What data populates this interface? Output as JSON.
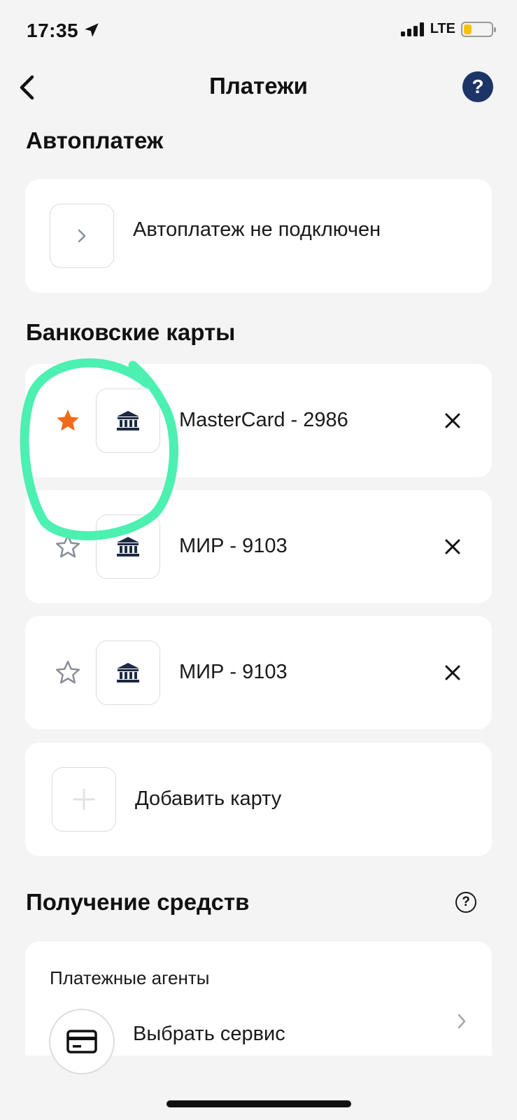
{
  "status_bar": {
    "time": "17:35",
    "network": "LTE",
    "battery_color": "#f5c400",
    "icons": [
      "location-arrow-icon",
      "signal-icon",
      "battery-icon"
    ]
  },
  "nav": {
    "title": "Платежи",
    "back_icon": "chevron-left-icon",
    "help_label": "?",
    "help_color": "#1d3566"
  },
  "autopay": {
    "section_title": "Автоплатеж",
    "status_text": "Автоплатеж не подключен",
    "icon": "chevron-right-icon"
  },
  "bank_cards": {
    "section_title": "Банковские карты",
    "cards": [
      {
        "label": "MasterCard - 2986",
        "favorite": true,
        "icon": "bank-icon"
      },
      {
        "label": "МИР - 9103",
        "favorite": false,
        "icon": "bank-icon"
      },
      {
        "label": "МИР - 9103",
        "favorite": false,
        "icon": "bank-icon"
      }
    ],
    "favorite_color": "#f26a1b",
    "add_card_label": "Добавить карту"
  },
  "receive_funds": {
    "section_title": "Получение средств",
    "help_label": "?",
    "agents_title": "Платежные агенты",
    "select_service_label": "Выбрать сервис",
    "icon": "credit-card-icon"
  },
  "annotation": {
    "highlight_color": "#4cf0b0"
  }
}
